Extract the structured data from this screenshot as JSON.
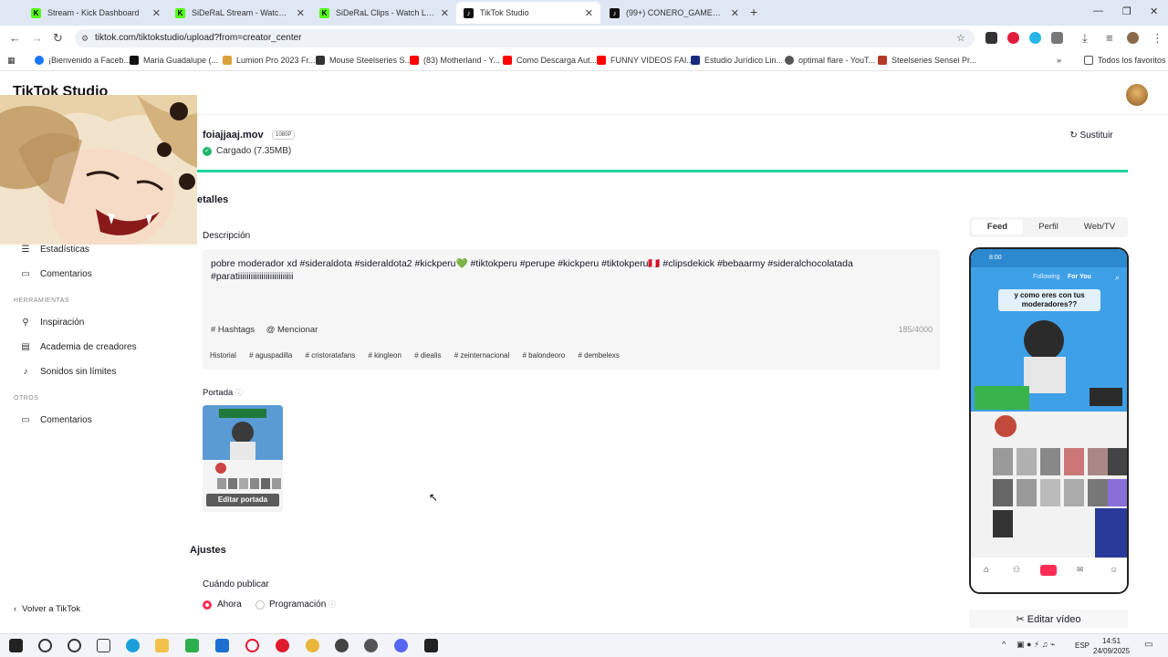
{
  "browser": {
    "tabs": [
      {
        "label": "Stream - Kick Dashboard",
        "color": "#53fc18",
        "active": false
      },
      {
        "label": "SiDeRaL Stream - Watch Live o",
        "color": "#53fc18",
        "active": false
      },
      {
        "label": "SiDeRaL Clips - Watch Live on",
        "color": "#53fc18",
        "active": false
      },
      {
        "label": "TikTok Studio",
        "color": "#111111",
        "active": true
      },
      {
        "label": "(99+) CONERO_GAMER (@cone",
        "color": "#111111",
        "active": false
      }
    ],
    "url": "tiktok.com/tiktokstudio/upload?from=creator_center",
    "bookmarks": [
      {
        "label": "¡Bienvenido a Faceb...",
        "color": "#1877f2"
      },
      {
        "label": "Maria Guadalupe (...",
        "color": "#111111"
      },
      {
        "label": "Lumion Pro 2023 Fr...",
        "color": "#d9a23b"
      },
      {
        "label": "Mouse Steelseries S...",
        "color": "#333333"
      },
      {
        "label": "(83) Motherland - Y...",
        "color": "#ff0000"
      },
      {
        "label": "Como Descarga Aut...",
        "color": "#ff0000"
      },
      {
        "label": "FUNNY VIDEOS FAI...",
        "color": "#ff0000"
      },
      {
        "label": "Estudio Jurídico Lin...",
        "color": "#1a2a7a"
      },
      {
        "label": "optimal flare - YouT...",
        "color": "#555555"
      },
      {
        "label": "Steelseries Sensei Pr...",
        "color": "#b23a2a"
      }
    ],
    "all_bookmarks": "Todos los favoritos"
  },
  "app": {
    "logo": "TikTok Studio"
  },
  "sidebar": {
    "items": [
      {
        "label": "Estadísticas",
        "icon": "chart-icon"
      },
      {
        "label": "Comentarios",
        "icon": "comment-icon"
      }
    ],
    "tools_header": "HERRAMIENTAS",
    "tools": [
      {
        "label": "Inspiración",
        "icon": "bulb-icon"
      },
      {
        "label": "Academia de creadores",
        "icon": "book-icon"
      },
      {
        "label": "Sonidos sin límites",
        "icon": "music-icon"
      }
    ],
    "others_header": "OTROS",
    "others": [
      {
        "label": "Comentarios",
        "icon": "feedback-icon"
      }
    ],
    "back": "Volver a TikTok"
  },
  "upload": {
    "filename": "foiajjaaj.mov",
    "resolution": "1080P",
    "status": "Cargado",
    "size": "(7.35MB)",
    "replace": "Sustituir",
    "progress": 1.0
  },
  "details": {
    "section_title": "etalles",
    "description_label": "Descripción",
    "description_text": "pobre moderador xd #sideraldota #sideraldota2 #kickperu💚 #tiktokperu #perupe #kickperu #tiktokperu🇵🇪 #clipsdekick #bebaarmy #sideralchocolatada #paratiiiiiiiiiiiiiiiiiiiiiiiiii",
    "hashtags_btn": "# Hashtags",
    "mention_btn": "@ Mencionar",
    "counter": "185/4000",
    "history_label": "Historial",
    "suggested_tags": [
      "# aguspadilla",
      "# cristoratafans",
      "# kingleon",
      "# diealis",
      "# zeinternacional",
      "# balondeoro",
      "# dembelexs"
    ],
    "cover_label": "Portada",
    "edit_cover": "Editar portada"
  },
  "settings": {
    "title": "Ajustes",
    "when_label": "Cuándo publicar",
    "now": "Ahora",
    "schedule": "Programación"
  },
  "preview": {
    "tabs": [
      "Feed",
      "Perfil",
      "Web/TV"
    ],
    "phone_time": "8:00",
    "following": "Following",
    "for_you": "For You",
    "caption": "y como eres con tus moderadores??",
    "edit_video": "Editar vídeo"
  },
  "taskbar": {
    "lang": "ESP",
    "time": "14:51",
    "date": "24/09/2025"
  }
}
